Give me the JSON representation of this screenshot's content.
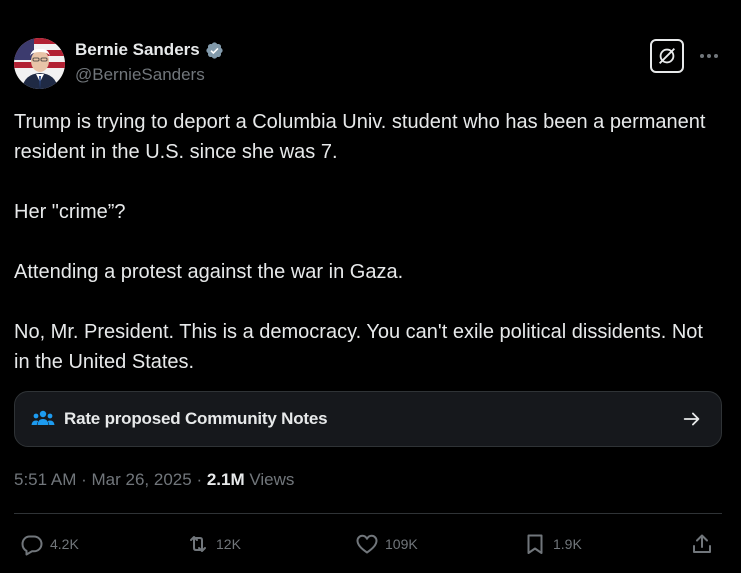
{
  "author": {
    "display_name": "Bernie Sanders",
    "handle": "@BernieSanders",
    "verified": true
  },
  "tweet": {
    "paragraphs": [
      "Trump is trying to deport a Columbia Univ. student who has been a permanent resident in the U.S. since she was 7.",
      "Her \"crime”?",
      "Attending a protest against the war in Gaza.",
      "No, Mr. President. This is a democracy. You can't exile political dissidents. Not in the United States."
    ]
  },
  "community_notes": {
    "label": "Rate proposed Community Notes",
    "icon": "people-icon"
  },
  "meta": {
    "time": "5:51 AM",
    "date": "Mar 26, 2025",
    "views_count": "2.1M",
    "views_label": "Views",
    "separator": "·"
  },
  "actions": {
    "replies": "4.2K",
    "reposts": "12K",
    "likes": "109K",
    "bookmarks": "1.9K"
  },
  "colors": {
    "background": "#000000",
    "text": "#e7e9ea",
    "muted": "#71767b",
    "verified": "#829aab",
    "community_icon": "#1d9bf0",
    "card": "#16181c",
    "border": "#2f3336"
  }
}
